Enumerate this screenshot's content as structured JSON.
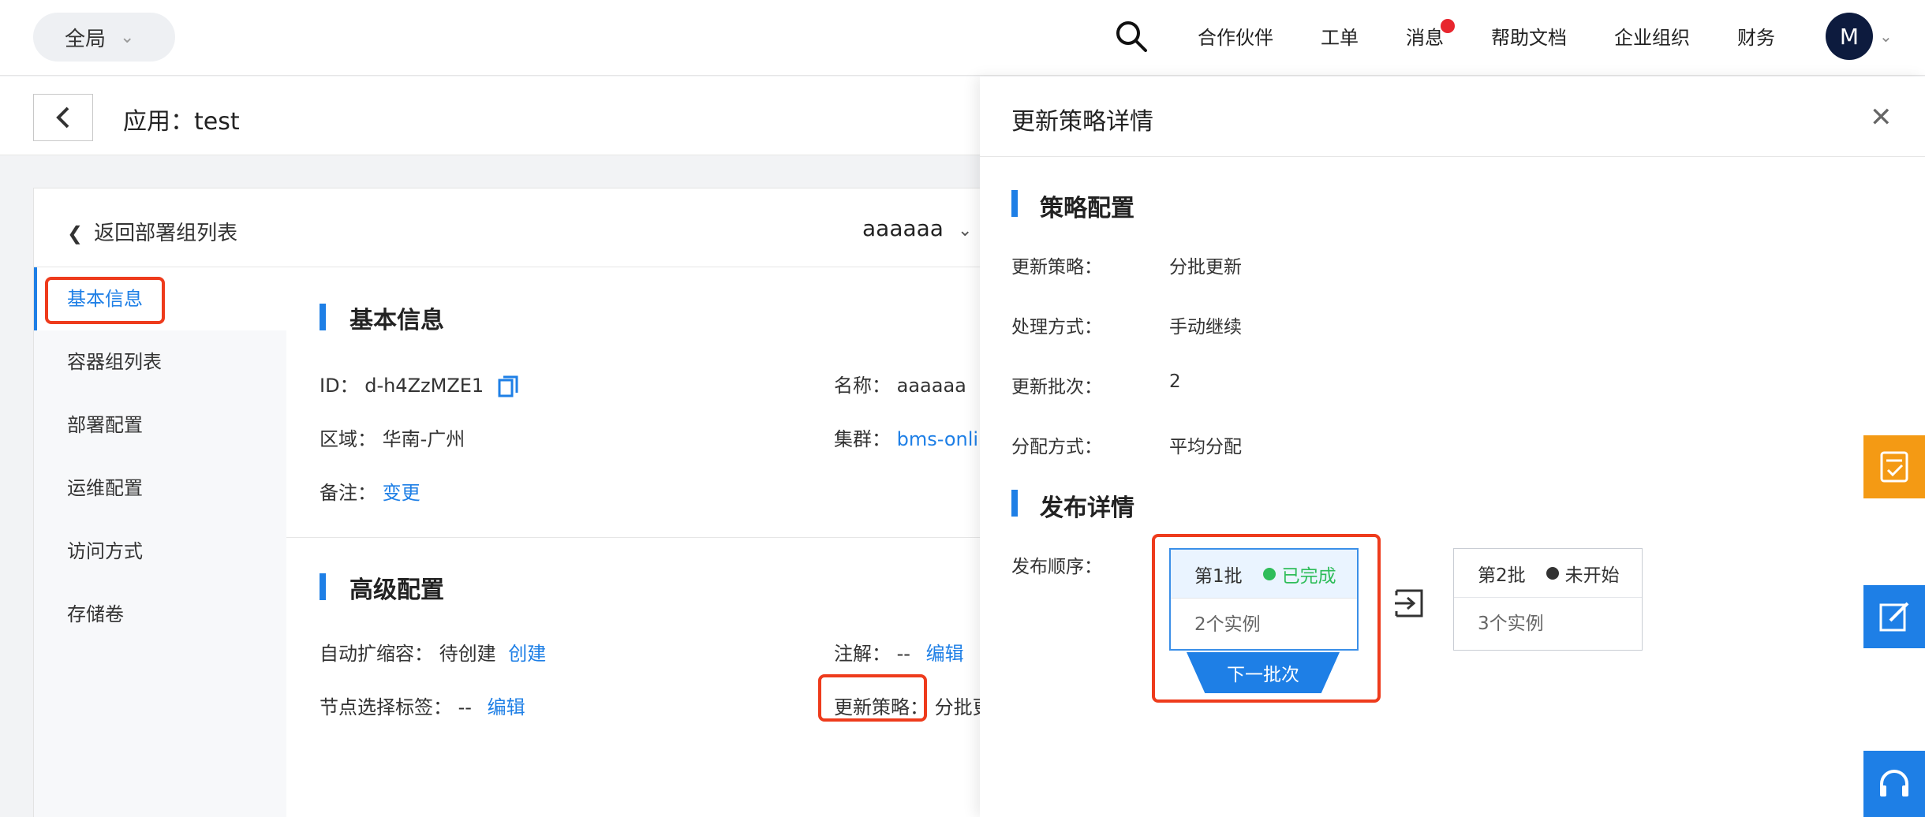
{
  "topnav": {
    "scope_label": "全局",
    "items": [
      "合作伙伴",
      "工单",
      "消息",
      "帮助文档",
      "企业组织",
      "财务"
    ],
    "avatar_initial": "M"
  },
  "app_header": {
    "title": "应用：test"
  },
  "card": {
    "back_label": "返回部署组列表",
    "group_name": "aaaaaa",
    "sidebar": [
      "基本信息",
      "容器组列表",
      "部署配置",
      "运维配置",
      "访问方式",
      "存储卷"
    ],
    "basic": {
      "title": "基本信息",
      "id_label": "ID：",
      "id_value": "d-h4ZzMZE1",
      "name_label": "名称：",
      "name_value": "aaaaaa",
      "region_label": "区域：",
      "region_value": "华南-广州",
      "cluster_label": "集群：",
      "cluster_value": "bms-onlir",
      "note_label": "备注：",
      "note_link": "变更"
    },
    "advanced": {
      "title": "高级配置",
      "autoscale_label": "自动扩缩容：",
      "autoscale_value": "待创建",
      "autoscale_link": "创建",
      "annot_label": "注解：",
      "annot_value": "--",
      "annot_link": "编辑",
      "node_label": "节点选择标签：",
      "node_value": "--",
      "node_link": "编辑",
      "strategy_label": "更新策略：",
      "strategy_value": "分批更"
    }
  },
  "drawer": {
    "title": "更新策略详情",
    "policy_title": "策略配置",
    "rows": [
      {
        "k": "更新策略：",
        "v": "分批更新"
      },
      {
        "k": "处理方式：",
        "v": "手动继续"
      },
      {
        "k": "更新批次：",
        "v": "2"
      },
      {
        "k": "分配方式：",
        "v": "平均分配"
      }
    ],
    "release_title": "发布详情",
    "order_label": "发布顺序：",
    "batches": [
      {
        "name": "第1批",
        "status": "已完成",
        "count": "2个实例"
      },
      {
        "name": "第2批",
        "status": "未开始",
        "count": "3个实例"
      }
    ],
    "next_button": "下一批次"
  },
  "colors": {
    "accent": "#1e7fe6",
    "highlight": "#ee3b1c",
    "success": "#2fbd5a",
    "pending": "#333333",
    "float_orange": "#f49a14"
  }
}
